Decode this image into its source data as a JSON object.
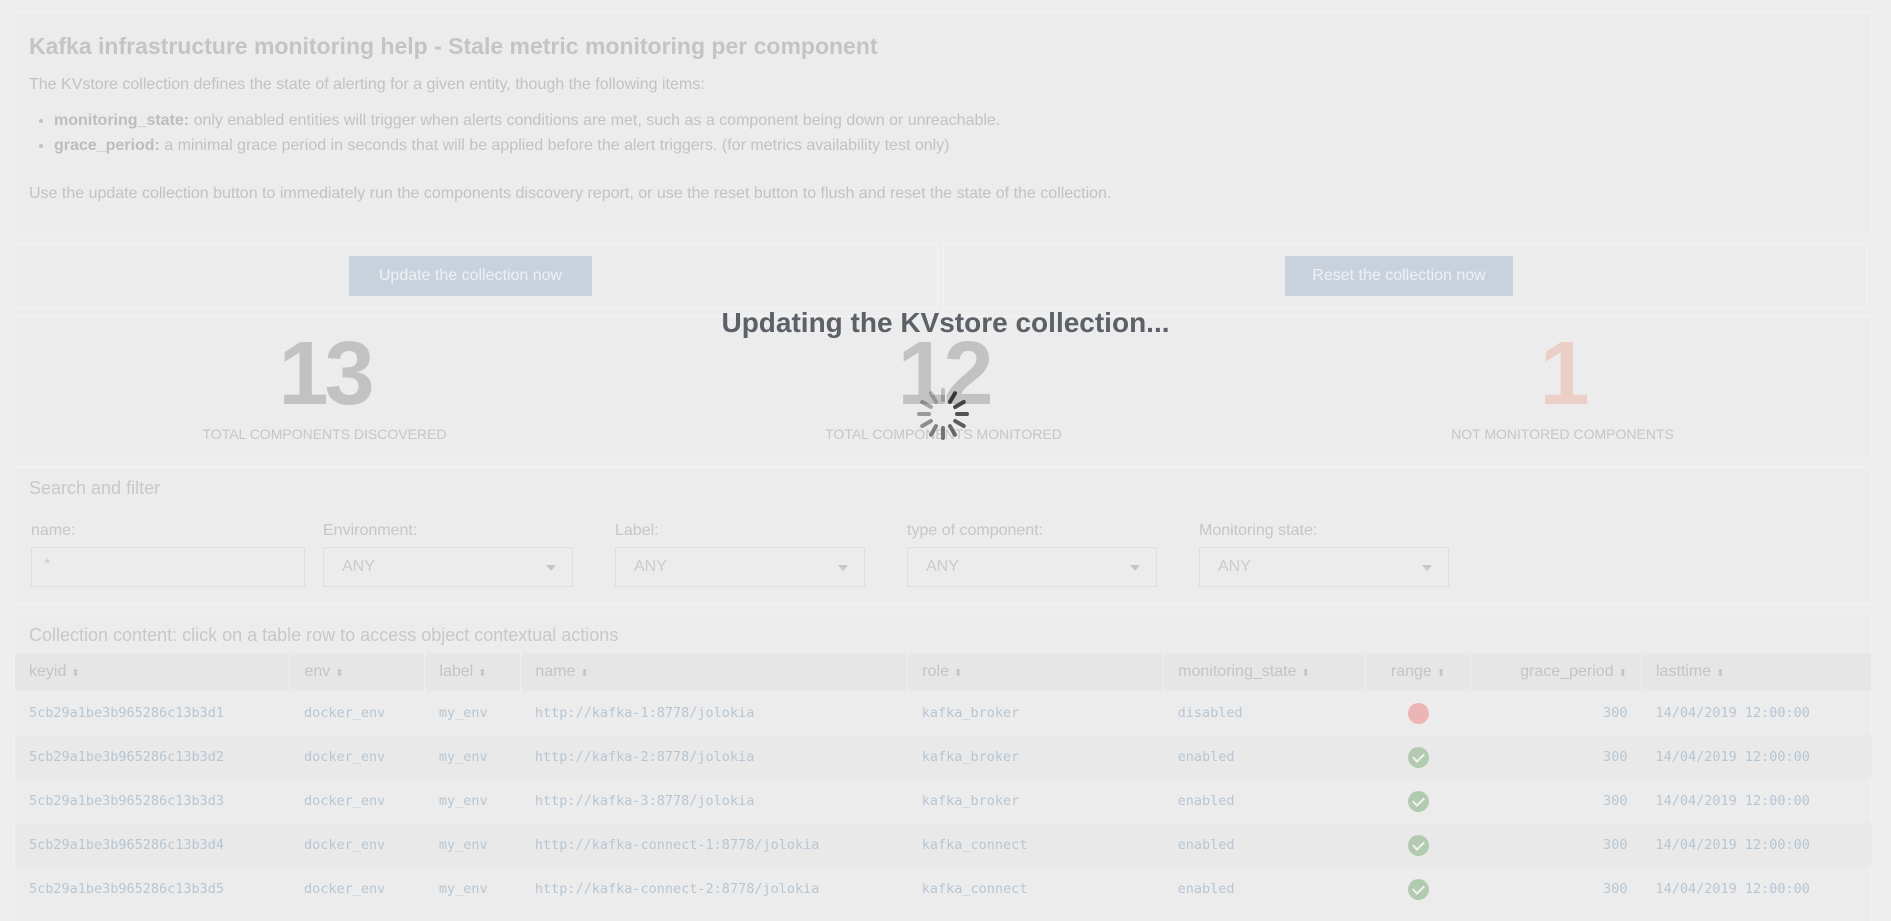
{
  "help": {
    "title": "Kafka infrastructure monitoring help - Stale metric monitoring per component",
    "intro": "The KVstore collection defines the state of alerting for a given entity, though the following items:",
    "items": [
      {
        "key": "monitoring_state:",
        "text": " only enabled entities will trigger when alerts conditions are met, such as a component being down or unreachable."
      },
      {
        "key": "grace_period:",
        "text": " a minimal grace period in seconds that will be applied before the alert triggers. (for metrics availability test only)"
      }
    ],
    "footer": "Use the update collection button to immediately run the components discovery report, or use the reset button to flush and reset the state of the collection."
  },
  "buttons": {
    "update_label": "Update the collection now",
    "reset_label": "Reset the collection now"
  },
  "singles": [
    {
      "value": "13",
      "label": "TOTAL COMPONENTS DISCOVERED",
      "color": "#c2c2c2"
    },
    {
      "value": "12",
      "label": "TOTAL COMPONENTS MONITORED",
      "color": "#c2c2c2"
    },
    {
      "value": "1",
      "label": "NOT MONITORED COMPONENTS",
      "color": "#ebcfc6"
    }
  ],
  "search": {
    "title": "Search and filter",
    "filters": [
      {
        "label": "name:",
        "value": "*",
        "kind": "text"
      },
      {
        "label": "Environment:",
        "value": "ANY",
        "kind": "dropdown"
      },
      {
        "label": "Label:",
        "value": "ANY",
        "kind": "dropdown"
      },
      {
        "label": "type of component:",
        "value": "ANY",
        "kind": "dropdown"
      },
      {
        "label": "Monitoring state:",
        "value": "ANY",
        "kind": "dropdown"
      }
    ]
  },
  "table": {
    "title": "Collection content: click on a table row to access object contextual actions",
    "columns": [
      "keyid",
      "env",
      "label",
      "name",
      "role",
      "monitoring_state",
      "range",
      "grace_period",
      "lasttime"
    ],
    "rows": [
      {
        "keyid": "5cb29a1be3b965286c13b3d1",
        "env": "docker_env",
        "label": "my_env",
        "name": "http://kafka-1:8778/jolokia",
        "role": "kafka_broker",
        "monitoring_state": "disabled",
        "range": "red",
        "grace_period": "300",
        "lasttime": "14/04/2019 12:00:00"
      },
      {
        "keyid": "5cb29a1be3b965286c13b3d2",
        "env": "docker_env",
        "label": "my_env",
        "name": "http://kafka-2:8778/jolokia",
        "role": "kafka_broker",
        "monitoring_state": "enabled",
        "range": "green",
        "grace_period": "300",
        "lasttime": "14/04/2019 12:00:00"
      },
      {
        "keyid": "5cb29a1be3b965286c13b3d3",
        "env": "docker_env",
        "label": "my_env",
        "name": "http://kafka-3:8778/jolokia",
        "role": "kafka_broker",
        "monitoring_state": "enabled",
        "range": "green",
        "grace_period": "300",
        "lasttime": "14/04/2019 12:00:00"
      },
      {
        "keyid": "5cb29a1be3b965286c13b3d4",
        "env": "docker_env",
        "label": "my_env",
        "name": "http://kafka-connect-1:8778/jolokia",
        "role": "kafka_connect",
        "monitoring_state": "enabled",
        "range": "green",
        "grace_period": "300",
        "lasttime": "14/04/2019 12:00:00"
      },
      {
        "keyid": "5cb29a1be3b965286c13b3d5",
        "env": "docker_env",
        "label": "my_env",
        "name": "http://kafka-connect-2:8778/jolokia",
        "role": "kafka_connect",
        "monitoring_state": "enabled",
        "range": "green",
        "grace_period": "300",
        "lasttime": "14/04/2019 12:00:00"
      }
    ]
  },
  "overlay": {
    "message": "Updating the KVstore collection...",
    "spinner_icon": "loading-spinner-icon"
  }
}
